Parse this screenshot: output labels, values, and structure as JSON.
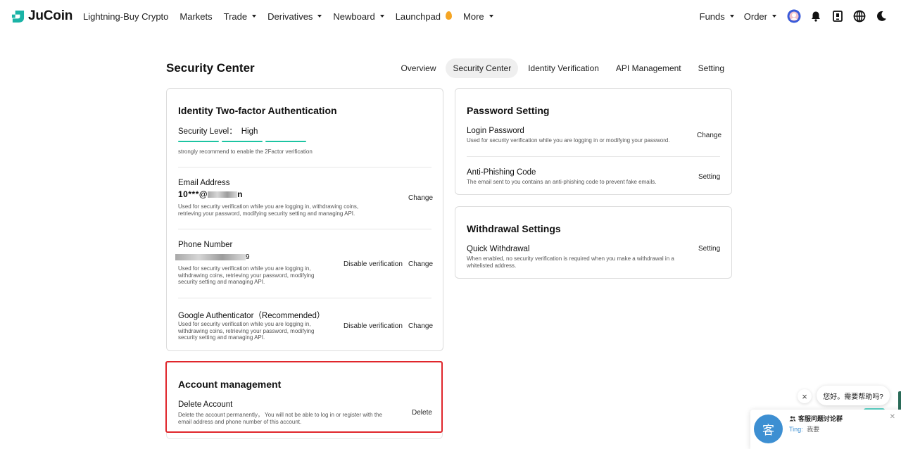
{
  "nav": {
    "brand": "JuCoin",
    "items": [
      {
        "label": "Lightning-Buy Crypto",
        "dropdown": false
      },
      {
        "label": "Markets",
        "dropdown": false
      },
      {
        "label": "Trade",
        "dropdown": true
      },
      {
        "label": "Derivatives",
        "dropdown": true
      },
      {
        "label": "Newboard",
        "dropdown": true
      },
      {
        "label": "Launchpad",
        "dropdown": false
      },
      {
        "label": "More",
        "dropdown": true
      }
    ],
    "right": {
      "funds": "Funds",
      "order": "Order"
    }
  },
  "header": {
    "title": "Security Center",
    "tabs": [
      "Overview",
      "Security Center",
      "Identity Verification",
      "API Management",
      "Setting"
    ],
    "active_tab": "Security Center"
  },
  "two_factor": {
    "title": "Identity Two-factor Authentication",
    "security_level_label": "Security Level：",
    "security_level_value": "High",
    "hint": "strongly recommend to enable the 2Factor verification",
    "email": {
      "title": "Email Address",
      "masked_value": "10***@",
      "masked_tail": "n",
      "desc": "Used for security verification while you are logging in, withdrawing coins, retrieving your password, modifying security setting and managing API.",
      "change": "Change"
    },
    "phone": {
      "title": "Phone Number",
      "masked_tail": "9",
      "desc": "Used for security verification while you are logging in, withdrawing coins, retrieving your password, modifying security setting and managing API.",
      "disable": "Disable verification",
      "change": "Change"
    },
    "google": {
      "title": "Google Authenticator（Recommended）",
      "desc": "Used for security verification while you are logging in, withdrawing coins, retrieving your password, modifying security setting and managing API.",
      "disable": "Disable verification",
      "change": "Change"
    }
  },
  "password": {
    "title": "Password Setting",
    "login": {
      "title": "Login Password",
      "desc": "Used for security verification while you are logging in or modifying your password.",
      "action": "Change"
    },
    "anti_phishing": {
      "title": "Anti-Phishing Code",
      "desc": "The email sent to you contains an anti-phishing code to prevent fake emails.",
      "action": "Setting"
    }
  },
  "withdrawal": {
    "title": "Withdrawal Settings",
    "quick": {
      "title": "Quick Withdrawal",
      "desc": "When enabled, no security verification is required when you make a withdrawal in a whitelisted address.",
      "action": "Setting"
    }
  },
  "account": {
    "title": "Account management",
    "delete": {
      "title": "Delete Account",
      "desc": "Delete the account permanently， You will not be able to log in or register with the email address and phone number of this account.",
      "action": "Delete"
    }
  },
  "chat": {
    "bubble": "您好。需要帮助吗?",
    "avatar_char": "客",
    "group": "客服问题讨论群",
    "sender": "Ting:",
    "message": "我要"
  },
  "colors": {
    "accent": "#1cc4a2",
    "highlight": "#e0262b",
    "chat_blue": "#3d8fd2"
  }
}
